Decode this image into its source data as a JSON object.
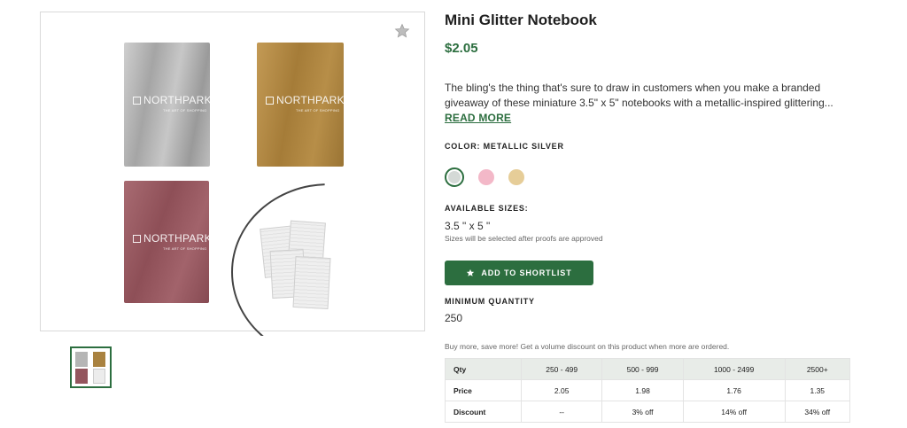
{
  "product": {
    "title": "Mini Glitter Notebook",
    "price": "$2.05",
    "description": "The bling's the thing that's sure to draw in customers when you make a branded giveaway of these miniature 3.5\" x 5\" notebooks with a metallic-inspired glittering...",
    "read_more": "READ MORE"
  },
  "image": {
    "brand_text": "NORTHPARK",
    "tagline": "THE ART OF SHOPPING",
    "favorite_icon": "star-icon"
  },
  "color": {
    "label": "COLOR: METALLIC SILVER",
    "swatches": [
      {
        "name": "metallic-silver",
        "hex": "#d4d9d6",
        "selected": true
      },
      {
        "name": "pink",
        "hex": "#f3b8c8",
        "selected": false
      },
      {
        "name": "gold",
        "hex": "#e6cd98",
        "selected": false
      }
    ]
  },
  "sizes": {
    "label": "AVAILABLE SIZES:",
    "value": "3.5 \" x 5 \"",
    "note": "Sizes will be selected after proofs are approved"
  },
  "shortlist": {
    "label": "ADD TO SHORTLIST",
    "icon": "star-icon"
  },
  "minimum": {
    "label": "MINIMUM QUANTITY",
    "value": "250"
  },
  "volume": {
    "note": "Buy more, save more! Get a volume discount on this product when more are ordered.",
    "headers": [
      "Qty",
      "250 - 499",
      "500 - 999",
      "1000 - 2499",
      "2500+"
    ],
    "rows": [
      {
        "label": "Price",
        "cells": [
          "2.05",
          "1.98",
          "1.76",
          "1.35"
        ]
      },
      {
        "label": "Discount",
        "cells": [
          "--",
          "3% off",
          "14% off",
          "34% off"
        ]
      }
    ]
  },
  "colors": {
    "accent": "#2c6e3f",
    "table_header_bg": "#e8ece8"
  }
}
